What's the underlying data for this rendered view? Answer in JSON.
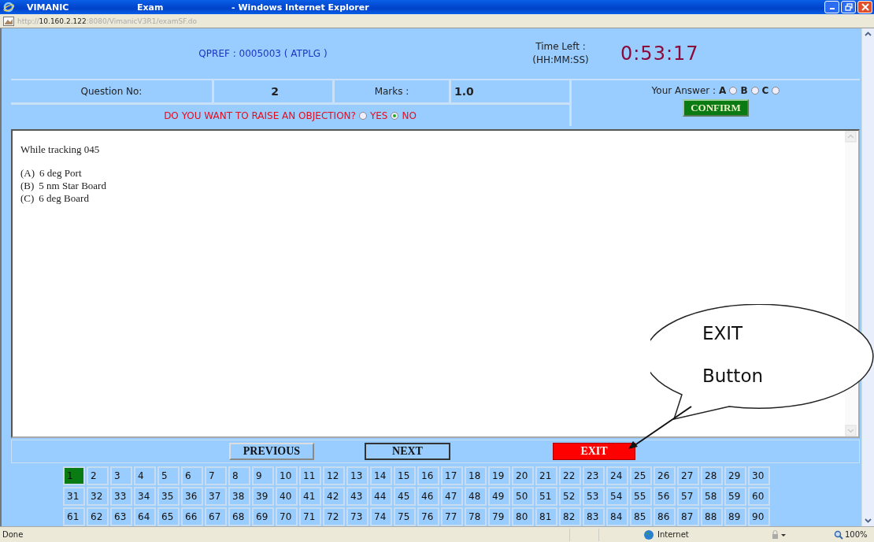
{
  "window": {
    "title_parts": [
      "VIMANIC",
      "Exam",
      "- Windows Internet Explorer"
    ]
  },
  "address_bar": {
    "url_parts": [
      {
        "text": "http://",
        "kind": "dim"
      },
      {
        "text": "10.160.2.122",
        "kind": "host"
      },
      {
        "text": ":8080/VimanicV3R1/examSF.do",
        "kind": "dim"
      }
    ]
  },
  "header": {
    "qpref": "QPREF : 0005003 ( ATPLG )",
    "time_left_label": "Time Left :",
    "time_format": "(HH:MM:SS)",
    "time_left": "0:53:17"
  },
  "info": {
    "question_no_label": "Question No:",
    "question_no": "2",
    "marks_label": "Marks :",
    "marks": "1.0",
    "answer_label": "Your Answer :",
    "answer_options": [
      {
        "label": "A",
        "selected": false
      },
      {
        "label": "B",
        "selected": false
      },
      {
        "label": "C",
        "selected": false
      }
    ]
  },
  "objection": {
    "prompt": "DO YOU WANT TO RAISE AN OBJECTION?",
    "options": [
      {
        "label": "YES",
        "selected": false
      },
      {
        "label": "NO",
        "selected": true
      }
    ]
  },
  "confirm_button": "CONFIRM",
  "question": {
    "stem": "While tracking 045",
    "options": [
      {
        "letter": "(A)",
        "text": "6 deg Port"
      },
      {
        "letter": "(B)",
        "text": "5 nm Star Board"
      },
      {
        "letter": "(C)",
        "text": "6 deg Board"
      }
    ]
  },
  "nav_buttons": [
    {
      "label": "PREVIOUS",
      "kind": "plain"
    },
    {
      "label": "NEXT",
      "kind": "outlined"
    },
    {
      "label": "EXIT",
      "kind": "danger"
    }
  ],
  "question_grid": [
    {
      "label": "1",
      "selected": true
    },
    {
      "label": "2",
      "selected": false
    },
    {
      "label": "3",
      "selected": false
    },
    {
      "label": "4",
      "selected": false
    },
    {
      "label": "5",
      "selected": false
    },
    {
      "label": "6",
      "selected": false
    },
    {
      "label": "7",
      "selected": false
    },
    {
      "label": "8",
      "selected": false
    },
    {
      "label": "9",
      "selected": false
    },
    {
      "label": "10",
      "selected": false
    },
    {
      "label": "11",
      "selected": false
    },
    {
      "label": "12",
      "selected": false
    },
    {
      "label": "13",
      "selected": false
    },
    {
      "label": "14",
      "selected": false
    },
    {
      "label": "15",
      "selected": false
    },
    {
      "label": "16",
      "selected": false
    },
    {
      "label": "17",
      "selected": false
    },
    {
      "label": "18",
      "selected": false
    },
    {
      "label": "19",
      "selected": false
    },
    {
      "label": "20",
      "selected": false
    },
    {
      "label": "21",
      "selected": false
    },
    {
      "label": "22",
      "selected": false
    },
    {
      "label": "23",
      "selected": false
    },
    {
      "label": "24",
      "selected": false
    },
    {
      "label": "25",
      "selected": false
    },
    {
      "label": "26",
      "selected": false
    },
    {
      "label": "27",
      "selected": false
    },
    {
      "label": "28",
      "selected": false
    },
    {
      "label": "29",
      "selected": false
    },
    {
      "label": "30",
      "selected": false
    },
    {
      "label": "31",
      "selected": false
    },
    {
      "label": "32",
      "selected": false
    },
    {
      "label": "33",
      "selected": false
    },
    {
      "label": "34",
      "selected": false
    },
    {
      "label": "35",
      "selected": false
    },
    {
      "label": "36",
      "selected": false
    },
    {
      "label": "37",
      "selected": false
    },
    {
      "label": "38",
      "selected": false
    },
    {
      "label": "39",
      "selected": false
    },
    {
      "label": "40",
      "selected": false
    },
    {
      "label": "41",
      "selected": false
    },
    {
      "label": "42",
      "selected": false
    },
    {
      "label": "43",
      "selected": false
    },
    {
      "label": "44",
      "selected": false
    },
    {
      "label": "45",
      "selected": false
    },
    {
      "label": "46",
      "selected": false
    },
    {
      "label": "47",
      "selected": false
    },
    {
      "label": "48",
      "selected": false
    },
    {
      "label": "49",
      "selected": false
    },
    {
      "label": "50",
      "selected": false
    },
    {
      "label": "51",
      "selected": false
    },
    {
      "label": "52",
      "selected": false
    },
    {
      "label": "53",
      "selected": false
    },
    {
      "label": "54",
      "selected": false
    },
    {
      "label": "55",
      "selected": false
    },
    {
      "label": "56",
      "selected": false
    },
    {
      "label": "57",
      "selected": false
    },
    {
      "label": "58",
      "selected": false
    },
    {
      "label": "59",
      "selected": false
    },
    {
      "label": "60",
      "selected": false
    },
    {
      "label": "61",
      "selected": false
    },
    {
      "label": "62",
      "selected": false
    },
    {
      "label": "63",
      "selected": false
    },
    {
      "label": "64",
      "selected": false
    },
    {
      "label": "65",
      "selected": false
    },
    {
      "label": "66",
      "selected": false
    },
    {
      "label": "67",
      "selected": false
    },
    {
      "label": "68",
      "selected": false
    },
    {
      "label": "69",
      "selected": false
    },
    {
      "label": "70",
      "selected": false
    },
    {
      "label": "71",
      "selected": false
    },
    {
      "label": "72",
      "selected": false
    },
    {
      "label": "73",
      "selected": false
    },
    {
      "label": "74",
      "selected": false
    },
    {
      "label": "75",
      "selected": false
    },
    {
      "label": "76",
      "selected": false
    },
    {
      "label": "77",
      "selected": false
    },
    {
      "label": "78",
      "selected": false
    },
    {
      "label": "79",
      "selected": false
    },
    {
      "label": "80",
      "selected": false
    },
    {
      "label": "81",
      "selected": false
    },
    {
      "label": "82",
      "selected": false
    },
    {
      "label": "83",
      "selected": false
    },
    {
      "label": "84",
      "selected": false
    },
    {
      "label": "85",
      "selected": false
    },
    {
      "label": "86",
      "selected": false
    },
    {
      "label": "87",
      "selected": false
    },
    {
      "label": "88",
      "selected": false
    },
    {
      "label": "89",
      "selected": false
    },
    {
      "label": "90",
      "selected": false
    }
  ],
  "status_bar": {
    "text": "Done",
    "zone": "Internet",
    "zoom": "100%"
  },
  "callout": {
    "lines": [
      "EXIT",
      "Button"
    ]
  }
}
